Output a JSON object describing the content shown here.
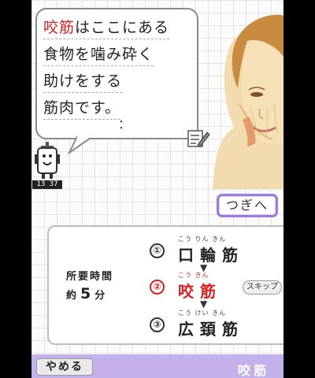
{
  "bubble": {
    "line1_red": "咬筋",
    "line1_rest": "はここにある",
    "line2": "食物を噛み砕く",
    "line3": "助けをする",
    "line4": "筋肉です。",
    "dots": "："
  },
  "clock": "13 37",
  "next_label": "つぎへ",
  "time": {
    "label": "所要時間",
    "prefix": "約",
    "minutes": "5",
    "unit": "分"
  },
  "steps": [
    {
      "number": "①",
      "ruby": "こう りん きん",
      "kanji": "口輪筋"
    },
    {
      "number": "②",
      "ruby": "こう   きん",
      "kanji": "咬筋"
    },
    {
      "number": "③",
      "ruby": "こう けい きん",
      "kanji": "広頚筋"
    }
  ],
  "skip_label": "スキップ",
  "quit_label": "やめる",
  "current_muscle": "咬筋",
  "colors": {
    "accent_red": "#d62020",
    "accent_purple": "#c4b1ec"
  },
  "icons": [
    "memo-pencil-icon",
    "robot-mascot-icon",
    "face-illustration"
  ]
}
